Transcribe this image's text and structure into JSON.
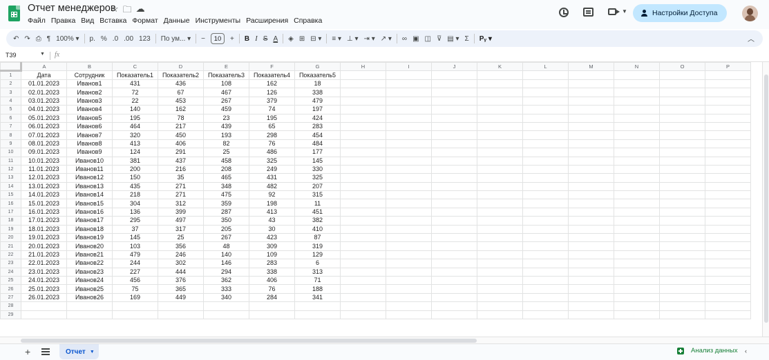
{
  "app": {
    "doc_title": "Отчет менеджеров",
    "menu": [
      "Файл",
      "Правка",
      "Вид",
      "Вставка",
      "Формат",
      "Данные",
      "Инструменты",
      "Расширения",
      "Справка"
    ],
    "share_label": "Настройки Доступа",
    "brand_color": "#1ea362",
    "accent_color": "#0b57d0"
  },
  "toolbar": {
    "zoom": "100%",
    "currency": "р.",
    "percent": "%",
    "dec_decrease": ".0",
    "dec_increase": ".00",
    "number_format": "123",
    "font": "По ум...",
    "minus": "−",
    "font_size": "10",
    "plus": "+",
    "bold": "B",
    "italic": "I",
    "strike": "S",
    "text_color": "A",
    "sigma": "Σ",
    "input_tools": "Pᵧ"
  },
  "formula_bar": {
    "cell_ref": "T39",
    "fx": "fx",
    "content": ""
  },
  "sheet": {
    "columns": [
      "A",
      "B",
      "C",
      "D",
      "E",
      "F",
      "G",
      "H",
      "I",
      "J",
      "K",
      "L",
      "M",
      "N",
      "O",
      "P"
    ],
    "rows": [
      [
        "Дата",
        "Сотрудник",
        "Показатель1",
        "Показатель2",
        "Показатель3",
        "Показатель4",
        "Показатель5"
      ],
      [
        "01.01.2023",
        "Иванов1",
        "431",
        "436",
        "108",
        "162",
        "18"
      ],
      [
        "02.01.2023",
        "Иванов2",
        "72",
        "67",
        "467",
        "126",
        "338"
      ],
      [
        "03.01.2023",
        "Иванов3",
        "22",
        "453",
        "267",
        "379",
        "479"
      ],
      [
        "04.01.2023",
        "Иванов4",
        "140",
        "162",
        "459",
        "74",
        "197"
      ],
      [
        "05.01.2023",
        "Иванов5",
        "195",
        "78",
        "23",
        "195",
        "424"
      ],
      [
        "06.01.2023",
        "Иванов6",
        "464",
        "217",
        "439",
        "65",
        "283"
      ],
      [
        "07.01.2023",
        "Иванов7",
        "320",
        "450",
        "193",
        "298",
        "454"
      ],
      [
        "08.01.2023",
        "Иванов8",
        "413",
        "406",
        "82",
        "76",
        "484"
      ],
      [
        "09.01.2023",
        "Иванов9",
        "124",
        "291",
        "25",
        "486",
        "177"
      ],
      [
        "10.01.2023",
        "Иванов10",
        "381",
        "437",
        "458",
        "325",
        "145"
      ],
      [
        "11.01.2023",
        "Иванов11",
        "200",
        "216",
        "208",
        "249",
        "330"
      ],
      [
        "12.01.2023",
        "Иванов12",
        "150",
        "35",
        "465",
        "431",
        "325"
      ],
      [
        "13.01.2023",
        "Иванов13",
        "435",
        "271",
        "348",
        "482",
        "207"
      ],
      [
        "14.01.2023",
        "Иванов14",
        "218",
        "271",
        "475",
        "92",
        "315"
      ],
      [
        "15.01.2023",
        "Иванов15",
        "304",
        "312",
        "359",
        "198",
        "11"
      ],
      [
        "16.01.2023",
        "Иванов16",
        "136",
        "399",
        "287",
        "413",
        "451"
      ],
      [
        "17.01.2023",
        "Иванов17",
        "295",
        "497",
        "350",
        "43",
        "382"
      ],
      [
        "18.01.2023",
        "Иванов18",
        "37",
        "317",
        "205",
        "30",
        "410"
      ],
      [
        "19.01.2023",
        "Иванов19",
        "145",
        "25",
        "267",
        "423",
        "87"
      ],
      [
        "20.01.2023",
        "Иванов20",
        "103",
        "356",
        "48",
        "309",
        "319"
      ],
      [
        "21.01.2023",
        "Иванов21",
        "479",
        "246",
        "140",
        "109",
        "129"
      ],
      [
        "22.01.2023",
        "Иванов22",
        "244",
        "302",
        "146",
        "283",
        "6"
      ],
      [
        "23.01.2023",
        "Иванов23",
        "227",
        "444",
        "294",
        "338",
        "313"
      ],
      [
        "24.01.2023",
        "Иванов24",
        "456",
        "376",
        "362",
        "406",
        "71"
      ],
      [
        "25.01.2023",
        "Иванов25",
        "75",
        "365",
        "333",
        "76",
        "188"
      ],
      [
        "26.01.2023",
        "Иванов26",
        "169",
        "449",
        "340",
        "284",
        "341"
      ]
    ]
  },
  "bottom": {
    "sheet_tab": "Отчет",
    "explore": "Анализ данных"
  }
}
